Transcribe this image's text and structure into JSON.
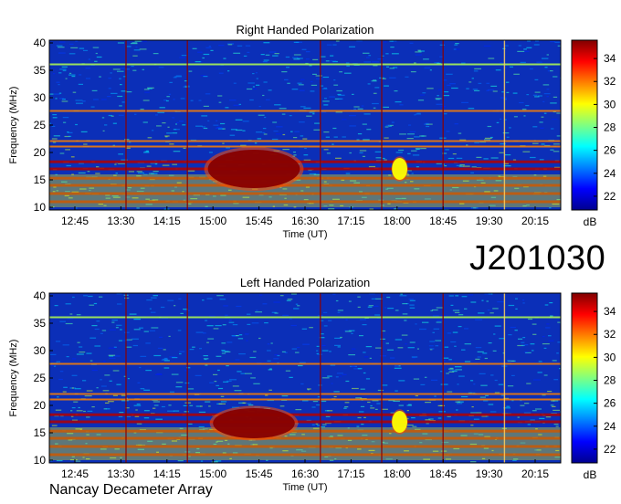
{
  "figure_label": "J201030",
  "footer": "Nancay Decameter Array",
  "colors": {
    "background_blue": "#0b2fb8",
    "burst_red": "#8b0000",
    "scale": [
      "#00008f",
      "#0000ff",
      "#0080ff",
      "#00ffff",
      "#80ff80",
      "#ffff00",
      "#ff8000",
      "#ff0000",
      "#800000"
    ]
  },
  "chart_data": [
    {
      "type": "heatmap",
      "title": "Right Handed Polarization",
      "xlabel": "Time (UT)",
      "ylabel": "Frequency (MHz)",
      "x_ticks": [
        "12:45",
        "13:30",
        "14:15",
        "15:00",
        "15:45",
        "16:30",
        "17:15",
        "18:00",
        "18:45",
        "19:30",
        "20:15"
      ],
      "y_ticks": [
        "10",
        "15",
        "20",
        "25",
        "30",
        "35",
        "40"
      ],
      "xlim": [
        "12:20",
        "20:40"
      ],
      "ylim": [
        9.5,
        40.5
      ],
      "colorbar": {
        "label": "dB",
        "ticks": [
          "22",
          "24",
          "26",
          "28",
          "30",
          "32",
          "34"
        ],
        "range": [
          20.8,
          35.6
        ]
      },
      "bursts": [
        {
          "t_start": "14:55",
          "t_end": "16:25",
          "f_low": 13.5,
          "f_high": 20.5,
          "level_db": 35.5
        },
        {
          "t_start": "17:55",
          "t_end": "18:10",
          "f_low": 15,
          "f_high": 19,
          "level_db": 30
        }
      ],
      "interference_bands_mhz": [
        11,
        12.5,
        14,
        15.3,
        17,
        18.3,
        21,
        22,
        27.5,
        36
      ],
      "vertical_lines": [
        "13:35",
        "14:35",
        "16:45",
        "17:45",
        "18:45",
        "19:45"
      ]
    },
    {
      "type": "heatmap",
      "title": "Left Handed Polarization",
      "xlabel": "Time (UT)",
      "ylabel": "Frequency (MHz)",
      "x_ticks": [
        "12:45",
        "13:30",
        "14:15",
        "15:00",
        "15:45",
        "16:30",
        "17:15",
        "18:00",
        "18:45",
        "19:30",
        "20:15"
      ],
      "y_ticks": [
        "10",
        "15",
        "20",
        "25",
        "30",
        "35",
        "40"
      ],
      "xlim": [
        "12:20",
        "20:40"
      ],
      "ylim": [
        9.5,
        40.5
      ],
      "colorbar": {
        "label": "dB",
        "ticks": [
          "22",
          "24",
          "26",
          "28",
          "30",
          "32",
          "34"
        ],
        "range": [
          20.8,
          35.6
        ]
      },
      "bursts": [
        {
          "t_start": "15:00",
          "t_end": "16:20",
          "f_low": 14,
          "f_high": 19.5,
          "level_db": 35.5
        },
        {
          "t_start": "17:55",
          "t_end": "18:10",
          "f_low": 15,
          "f_high": 19,
          "level_db": 30
        }
      ],
      "interference_bands_mhz": [
        11,
        12.5,
        14,
        15.3,
        17,
        18.3,
        21,
        22,
        27.5,
        36
      ],
      "vertical_lines": [
        "13:35",
        "14:35",
        "16:45",
        "17:45",
        "18:45",
        "19:45"
      ]
    }
  ]
}
